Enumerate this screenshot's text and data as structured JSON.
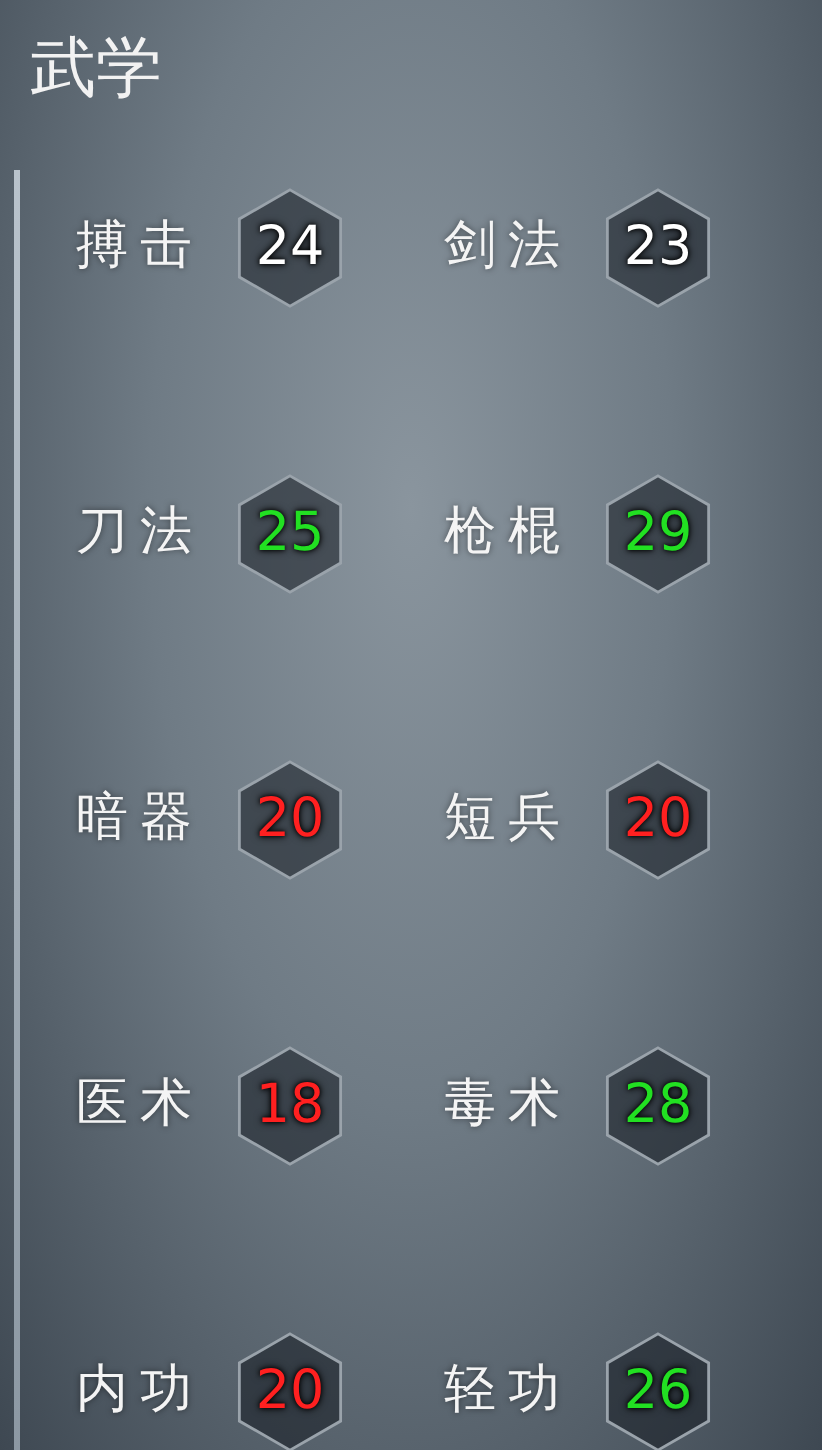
{
  "title": "武学",
  "skills": [
    {
      "name": "搏击",
      "value": "24",
      "color": "#ffffff"
    },
    {
      "name": "剑法",
      "value": "23",
      "color": "#ffffff"
    },
    {
      "name": "刀法",
      "value": "25",
      "color": "#22e022"
    },
    {
      "name": "枪棍",
      "value": "29",
      "color": "#22e022"
    },
    {
      "name": "暗器",
      "value": "20",
      "color": "#ff2020"
    },
    {
      "name": "短兵",
      "value": "20",
      "color": "#ff2020"
    },
    {
      "name": "医术",
      "value": "18",
      "color": "#ff2020"
    },
    {
      "name": "毒术",
      "value": "28",
      "color": "#22e022"
    },
    {
      "name": "内功",
      "value": "20",
      "color": "#ff2020"
    },
    {
      "name": "轻功",
      "value": "26",
      "color": "#22e022"
    }
  ]
}
